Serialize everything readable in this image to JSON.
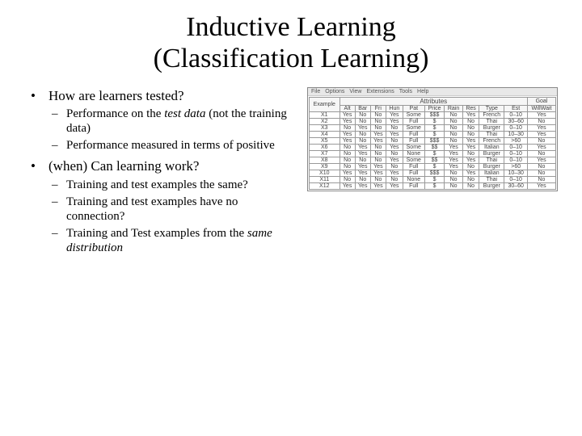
{
  "title_line1": "Inductive Learning",
  "title_line2": "(Classification Learning)",
  "bullets": [
    {
      "text": "How are learners tested?",
      "subs": [
        {
          "pre": "Performance on the ",
          "em": "test data",
          "post": " (not the training data)"
        },
        {
          "pre": "Performance measured in terms of positive",
          "em": "",
          "post": ""
        }
      ]
    },
    {
      "text": "(when) Can learning work?",
      "subs": [
        {
          "pre": "Training and test examples the same?",
          "em": "",
          "post": ""
        },
        {
          "pre": "Training and test examples have no connection?",
          "em": "",
          "post": ""
        },
        {
          "pre": "Training and Test examples from the ",
          "em": "same distribution",
          "post": ""
        }
      ]
    }
  ],
  "menubar": [
    "File",
    "Options",
    "View",
    "Extensions",
    "Tools",
    "Help"
  ],
  "grouped_headers": {
    "example": "Example",
    "attributes": "Attributes",
    "goal": "Goal"
  },
  "columns": [
    "Alt",
    "Bar",
    "Fri",
    "Hun",
    "Pat",
    "Price",
    "Rain",
    "Res",
    "Type",
    "Est",
    "WillWait"
  ],
  "rows": [
    [
      "X1",
      "Yes",
      "No",
      "No",
      "Yes",
      "Some",
      "$$$",
      "No",
      "Yes",
      "French",
      "0–10",
      "Yes"
    ],
    [
      "X2",
      "Yes",
      "No",
      "No",
      "Yes",
      "Full",
      "$",
      "No",
      "No",
      "Thai",
      "30–60",
      "No"
    ],
    [
      "X3",
      "No",
      "Yes",
      "No",
      "No",
      "Some",
      "$",
      "No",
      "No",
      "Burger",
      "0–10",
      "Yes"
    ],
    [
      "X4",
      "Yes",
      "No",
      "Yes",
      "Yes",
      "Full",
      "$",
      "No",
      "No",
      "Thai",
      "10–30",
      "Yes"
    ],
    [
      "X5",
      "Yes",
      "No",
      "Yes",
      "No",
      "Full",
      "$$$",
      "No",
      "Yes",
      "French",
      "&gt;60",
      "No"
    ],
    [
      "X6",
      "No",
      "Yes",
      "No",
      "Yes",
      "Some",
      "$$",
      "Yes",
      "Yes",
      "Italian",
      "0–10",
      "Yes"
    ],
    [
      "X7",
      "No",
      "Yes",
      "No",
      "No",
      "None",
      "$",
      "Yes",
      "No",
      "Burger",
      "0–10",
      "No"
    ],
    [
      "X8",
      "No",
      "No",
      "No",
      "Yes",
      "Some",
      "$$",
      "Yes",
      "Yes",
      "Thai",
      "0–10",
      "Yes"
    ],
    [
      "X9",
      "No",
      "Yes",
      "Yes",
      "No",
      "Full",
      "$",
      "Yes",
      "No",
      "Burger",
      "&gt;60",
      "No"
    ],
    [
      "X10",
      "Yes",
      "Yes",
      "Yes",
      "Yes",
      "Full",
      "$$$",
      "No",
      "Yes",
      "Italian",
      "10–30",
      "No"
    ],
    [
      "X11",
      "No",
      "No",
      "No",
      "No",
      "None",
      "$",
      "No",
      "No",
      "Thai",
      "0–10",
      "No"
    ],
    [
      "X12",
      "Yes",
      "Yes",
      "Yes",
      "Yes",
      "Full",
      "$",
      "No",
      "No",
      "Burger",
      "30–60",
      "Yes"
    ]
  ]
}
